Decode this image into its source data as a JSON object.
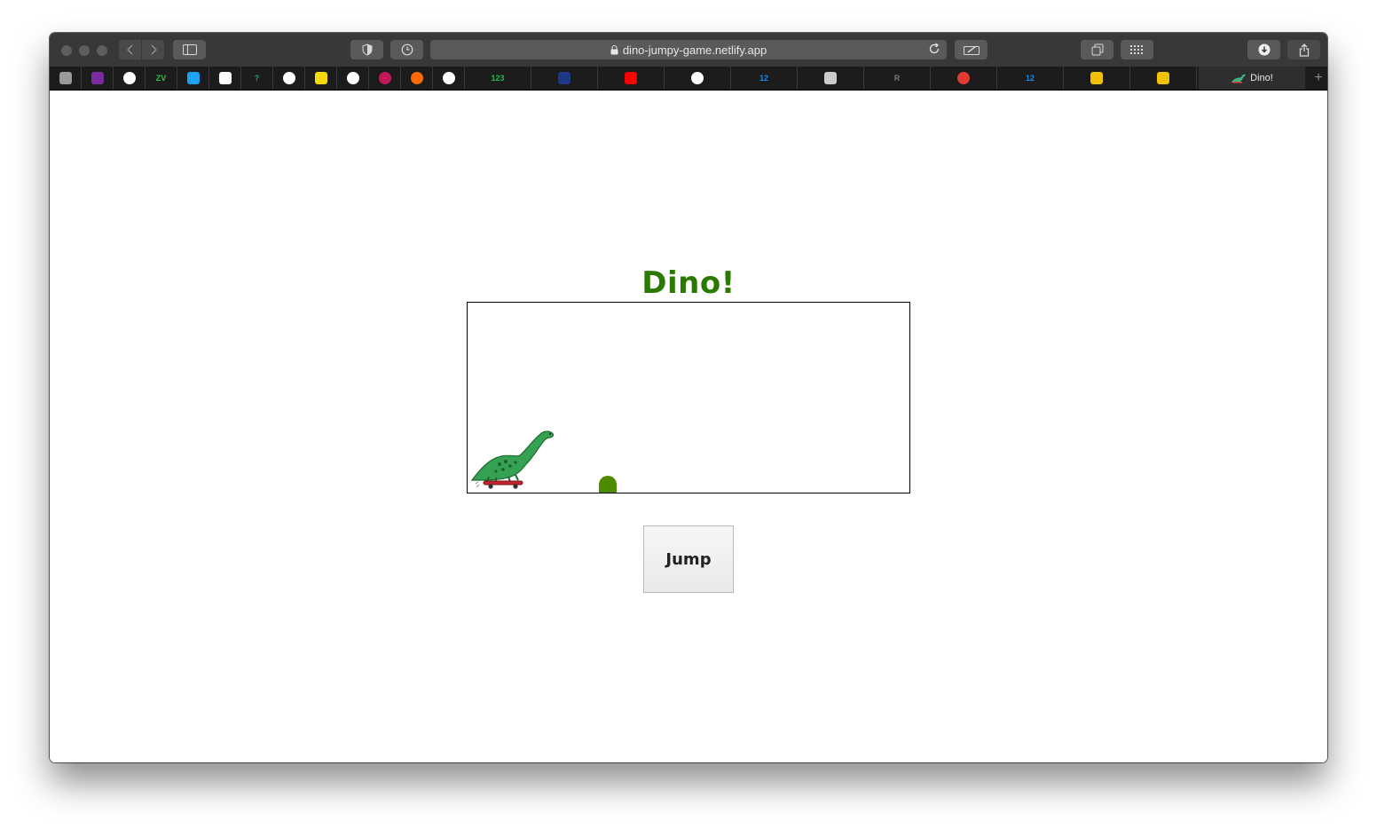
{
  "browser": {
    "url": "dino-jumpy-game.netlify.app",
    "active_tab_title": "Dino!",
    "favorites": [
      {
        "icon": "apple-icon",
        "color": "#9a9a9a"
      },
      {
        "icon": "purple-logo-icon",
        "color": "#7b2aa0"
      },
      {
        "icon": "github-icon",
        "color": "#ffffff"
      },
      {
        "icon": "zv-icon",
        "text": "ZV",
        "color": "#2fbf4a"
      },
      {
        "icon": "twitter-icon",
        "color": "#1da1f2"
      },
      {
        "icon": "nytimes-icon",
        "color": "#ffffff"
      },
      {
        "icon": "question-icon",
        "text": "?",
        "color": "#1fa463"
      },
      {
        "icon": "github-icon",
        "color": "#ffffff"
      },
      {
        "icon": "sticky-note-icon",
        "color": "#f5d90a"
      },
      {
        "icon": "github-icon",
        "color": "#ffffff"
      },
      {
        "icon": "play-circle-icon",
        "color": "#c2185b"
      },
      {
        "icon": "firefox-icon",
        "color": "#ff6a00"
      },
      {
        "icon": "google-icon",
        "color": "#ffffff"
      },
      {
        "icon": "numbers-icon",
        "text": "123",
        "color": "#2bb24c"
      },
      {
        "icon": "wave-logo-icon",
        "color": "#1d3a8a"
      },
      {
        "icon": "youtube-icon",
        "color": "#ff0000"
      },
      {
        "icon": "github-icon",
        "color": "#ffffff"
      },
      {
        "icon": "grid-numbers-icon",
        "text": "12",
        "color": "#1e88e5"
      },
      {
        "icon": "stick-figure-icon",
        "color": "#cccccc"
      },
      {
        "icon": "r-letter-icon",
        "text": "R",
        "color": "#777777"
      },
      {
        "icon": "pokeball-icon",
        "color": "#e53935"
      },
      {
        "icon": "grid-numbers-icon",
        "text": "12",
        "color": "#1e88e5"
      },
      {
        "icon": "helmet-icon",
        "color": "#f2c200"
      },
      {
        "icon": "bird-icon",
        "color": "#f2c200"
      }
    ]
  },
  "page": {
    "title": "Dino!",
    "title_color": "#2a7a00",
    "jump_label": "Jump",
    "cactus_color": "#4f8b00"
  }
}
